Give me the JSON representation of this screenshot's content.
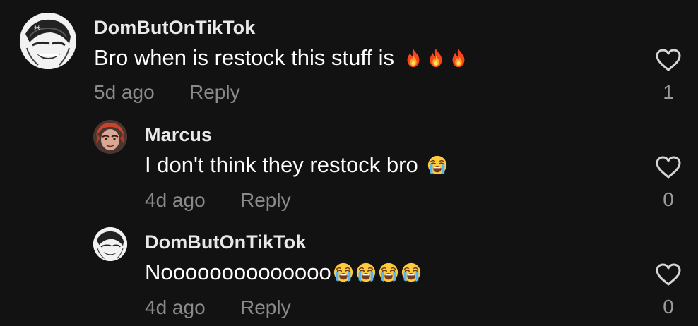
{
  "comments": [
    {
      "username": "DomButOnTikTok",
      "text": "Bro when is restock this stuff is",
      "emoji": [
        "fire-icon",
        "fire-icon",
        "fire-icon"
      ],
      "time": "5d ago",
      "reply_label": "Reply",
      "likes": "1",
      "avatar": "manga-face-avatar"
    },
    {
      "username": "Marcus",
      "text": "I don't think they restock bro",
      "emoji": [
        "loudly-crying-face-icon"
      ],
      "time": "4d ago",
      "reply_label": "Reply",
      "likes": "0",
      "avatar": "red-hair-anime-avatar"
    },
    {
      "username": "DomButOnTikTok",
      "text": "Noooooooooooooo",
      "emoji": [
        "loudly-crying-face-icon",
        "loudly-crying-face-icon",
        "loudly-crying-face-icon",
        "loudly-crying-face-icon"
      ],
      "time": "4d ago",
      "reply_label": "Reply",
      "likes": "0",
      "avatar": "manga-face-avatar"
    }
  ],
  "colors": {
    "background": "#121212",
    "username": "#e9e9e9",
    "text": "#ffffff",
    "meta": "#8a8a8a"
  }
}
